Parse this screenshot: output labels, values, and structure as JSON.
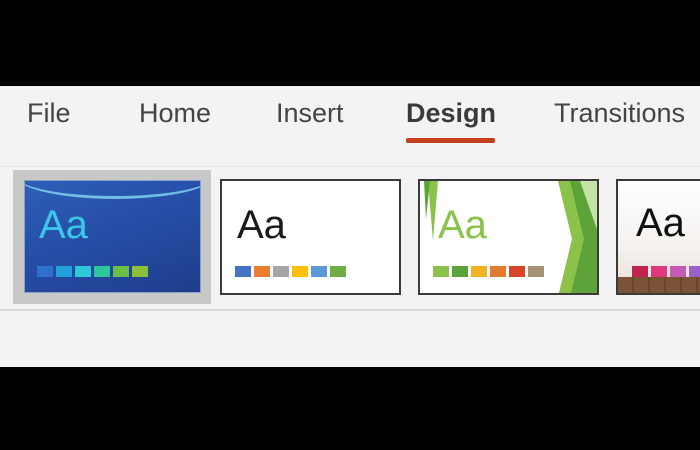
{
  "tabs": [
    {
      "label": "File"
    },
    {
      "label": "Home"
    },
    {
      "label": "Insert"
    },
    {
      "label": "Design",
      "active": true
    },
    {
      "label": "Transitions"
    }
  ],
  "accent_color": "#c43e1c",
  "themes": [
    {
      "sample": "Aa",
      "selected": true,
      "colors": [
        "#2f6fce",
        "#21a0dd",
        "#2fc8d8",
        "#2ec79a",
        "#6cc04a",
        "#8ebf3a"
      ]
    },
    {
      "sample": "Aa",
      "selected": false,
      "colors": [
        "#4472c4",
        "#ed7d31",
        "#a5a5a5",
        "#ffc000",
        "#5b9bd5",
        "#70ad47"
      ]
    },
    {
      "sample": "Aa",
      "selected": false,
      "colors": [
        "#8bc34a",
        "#5da339",
        "#f0b323",
        "#e27b2f",
        "#d9442b",
        "#a39272"
      ]
    },
    {
      "sample": "Aa",
      "selected": false,
      "colors": [
        "#c0244e",
        "#e0387d",
        "#c45ab3",
        "#9a62c6",
        "#7a6ac9"
      ]
    }
  ]
}
